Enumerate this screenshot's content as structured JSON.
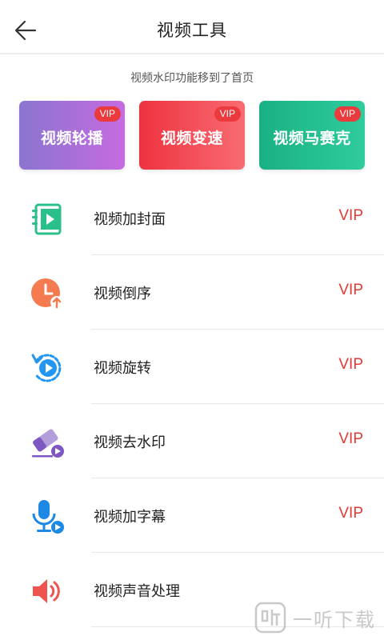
{
  "header": {
    "title": "视频工具",
    "back_icon": "arrow-left-icon"
  },
  "notice": "视频水印功能移到了首页",
  "feature_cards": [
    {
      "label": "视频轮播",
      "badge": "VIP",
      "color_start": "#8a75cf",
      "color_end": "#c66be0"
    },
    {
      "label": "视频变速",
      "badge": "VIP",
      "color_start": "#ee3340",
      "color_end": "#f86b72"
    },
    {
      "label": "视频马赛克",
      "badge": "VIP",
      "color_start": "#19b183",
      "color_end": "#2fcc9c"
    }
  ],
  "tools": [
    {
      "label": "视频加封面",
      "vip": "VIP",
      "icon": "video-cover-icon",
      "icon_color": "#2bbf8a"
    },
    {
      "label": "视频倒序",
      "vip": "VIP",
      "icon": "clock-reverse-icon",
      "icon_color": "#f47b4f"
    },
    {
      "label": "视频旋转",
      "vip": "VIP",
      "icon": "rotate-play-icon",
      "icon_color": "#2196f3"
    },
    {
      "label": "视频去水印",
      "vip": "VIP",
      "icon": "eraser-icon",
      "icon_color": "#7e57c2"
    },
    {
      "label": "视频加字幕",
      "vip": "VIP",
      "icon": "microphone-icon",
      "icon_color": "#1e88e5"
    },
    {
      "label": "视频声音处理",
      "vip": "",
      "icon": "speaker-icon",
      "icon_color": "#ef5350"
    }
  ],
  "colors": {
    "vip_text": "#e53935",
    "badge_bg": "#ea3a3d"
  },
  "watermark": {
    "text": "一听下载",
    "logo": "ting-logo"
  }
}
